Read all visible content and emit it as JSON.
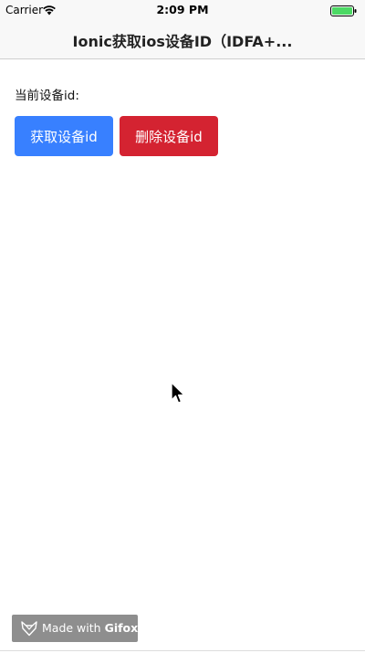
{
  "status_bar": {
    "carrier": "Carrier",
    "time": "2:09 PM",
    "battery_level": 1.0,
    "battery_color": "#4cd964"
  },
  "nav": {
    "title": "Ionic获取ios设备ID（IDFA+..."
  },
  "content": {
    "device_id_label": "当前设备id:",
    "get_button_label": "获取设备id",
    "delete_button_label": "删除设备id"
  },
  "colors": {
    "primary_button": "#3880ff",
    "danger_button": "#d42331"
  },
  "watermark": {
    "prefix": "Made with",
    "brand": "Gifox"
  }
}
